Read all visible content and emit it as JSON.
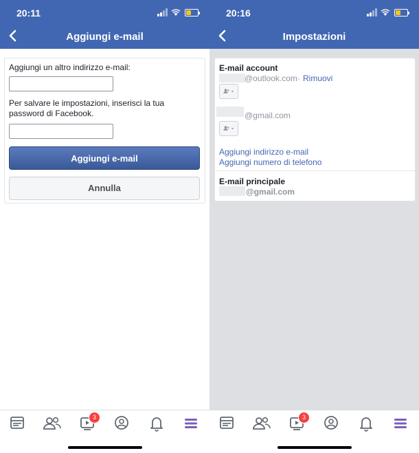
{
  "left": {
    "time": "20:11",
    "title": "Aggiungi e-mail",
    "add_label": "Aggiungi un altro indirizzo e-mail:",
    "email_value": "",
    "password_label": "Per salvare le impostazioni, inserisci la tua password di Facebook.",
    "password_value": "",
    "add_button": "Aggiungi e-mail",
    "cancel_button": "Annulla",
    "badge_count": "3"
  },
  "right": {
    "time": "20:16",
    "title": "Impostazioni",
    "email_account_label": "E-mail account",
    "outlook_email": "@outlook.com",
    "separator": "·",
    "remove_link": "Rimuovi",
    "gmail_email": "@gmail.com",
    "add_email_link": "Aggiungi indirizzo e-mail",
    "add_phone_link": "Aggiungi numero di telefono",
    "primary_label": "E-mail principale",
    "primary_email": "@gmail.com",
    "badge_count": "3"
  },
  "colors": {
    "brand": "#4267b2",
    "badge": "#fa3e3e",
    "nav_active": "#7a5eb8"
  },
  "icons": [
    "back-chevron-icon",
    "signal-icon",
    "wifi-icon",
    "battery-icon",
    "feed-icon",
    "friends-icon",
    "watch-icon",
    "profile-icon",
    "notifications-icon",
    "menu-icon",
    "audience-selector-icon"
  ]
}
